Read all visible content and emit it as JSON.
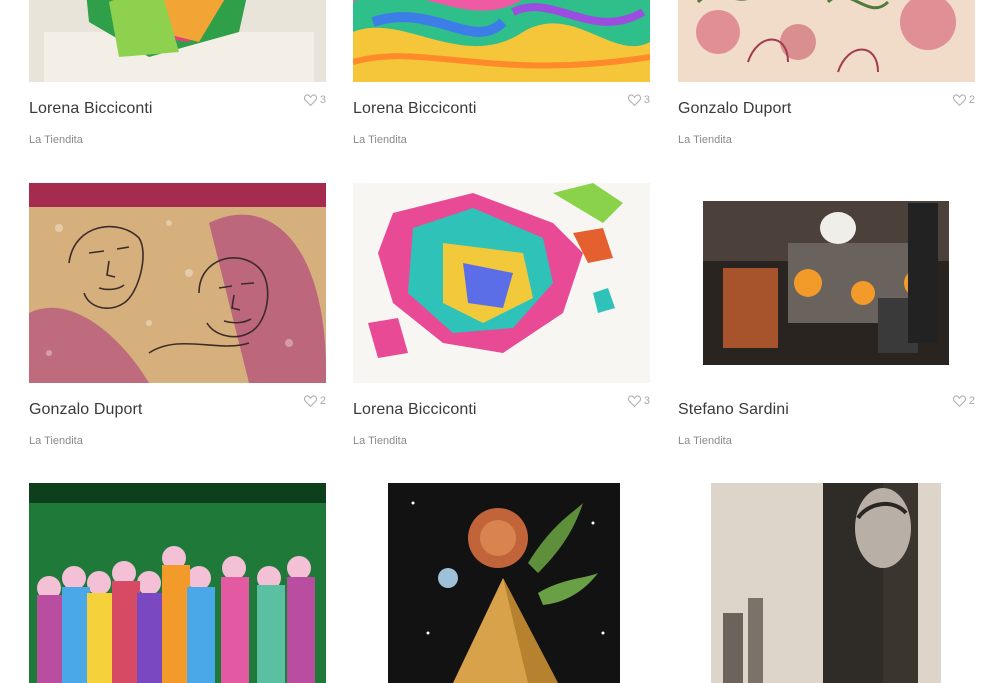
{
  "products": [
    {
      "artist": "Lorena Bicciconti",
      "shop": "La Tiendita",
      "likes": "3",
      "art_icon": "abstract-paper-sculpture"
    },
    {
      "artist": "Lorena Bicciconti",
      "shop": "La Tiendita",
      "likes": "3",
      "art_icon": "colorful-marbled-abstract"
    },
    {
      "artist": "Gonzalo Duport",
      "shop": "La Tiendita",
      "likes": "2",
      "art_icon": "floral-faces-drawing"
    },
    {
      "artist": "Gonzalo Duport",
      "shop": "La Tiendita",
      "likes": "2",
      "art_icon": "pink-faces-drawing"
    },
    {
      "artist": "Lorena Bicciconti",
      "shop": "La Tiendita",
      "likes": "3",
      "art_icon": "colorful-shard-heart"
    },
    {
      "artist": "Stefano Sardini",
      "shop": "La Tiendita",
      "likes": "2",
      "art_icon": "retro-lab-collage"
    },
    {
      "artist": "",
      "shop": "",
      "likes": "",
      "art_icon": "green-crowd-painting"
    },
    {
      "artist": "",
      "shop": "",
      "likes": "",
      "art_icon": "space-pyramid-collage"
    },
    {
      "artist": "",
      "shop": "",
      "likes": "",
      "art_icon": "city-portrait-collage"
    }
  ],
  "colors": {
    "artist_text": "#3a3a3a",
    "shop_text": "#8a8a8a",
    "likes_text": "#a9a9a9"
  }
}
